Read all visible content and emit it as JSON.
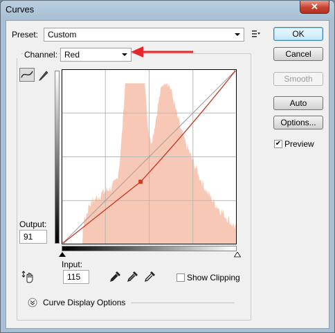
{
  "window": {
    "title": "Curves",
    "close_label": "✕"
  },
  "preset": {
    "label": "Preset:",
    "value": "Custom",
    "menu_icon": "preset-options-icon"
  },
  "channel": {
    "label": "Channel:",
    "value": "Red"
  },
  "buttons": {
    "ok": "OK",
    "cancel": "Cancel",
    "smooth": "Smooth",
    "auto": "Auto",
    "options": "Options..."
  },
  "preview": {
    "label": "Preview",
    "checked": true
  },
  "output": {
    "label": "Output:",
    "value": "91"
  },
  "input": {
    "label": "Input:",
    "value": "115"
  },
  "show_clipping": {
    "label": "Show Clipping",
    "checked": false
  },
  "curve_display_options": {
    "label": "Curve Display Options"
  },
  "annotation": {
    "arrow_color": "#e8262a"
  },
  "colors": {
    "histogram": "#f8c8b6",
    "curve": "#c8321e",
    "point": "#d43a1e",
    "grid": "#b8b8b8"
  },
  "curve_points": [
    {
      "input": 0,
      "output": 0
    },
    {
      "input": 115,
      "output": 91
    },
    {
      "input": 255,
      "output": 255
    }
  ]
}
